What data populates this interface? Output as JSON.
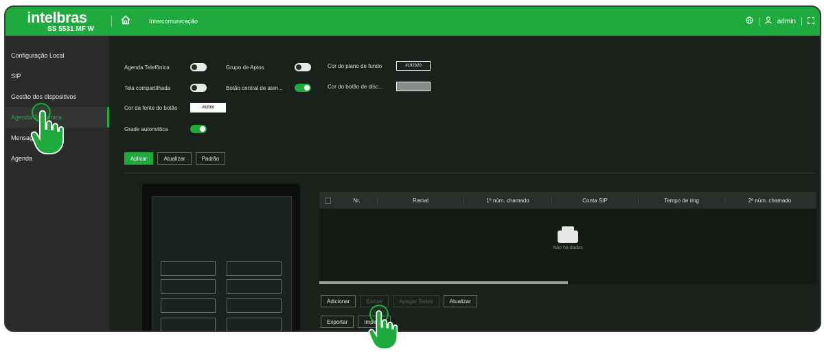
{
  "header": {
    "brand": "intelbras",
    "model": "SS 5531 MF W",
    "title": "Intercomunicação",
    "user": "admin"
  },
  "sidebar": {
    "items": [
      {
        "label": "Configuração Local",
        "active": false
      },
      {
        "label": "SIP",
        "active": false
      },
      {
        "label": "Gestão dos dispositivos",
        "active": false
      },
      {
        "label": "Agenda Telefônica",
        "active": true
      },
      {
        "label": "Mensagens",
        "active": false
      },
      {
        "label": "Agenda",
        "active": false
      }
    ]
  },
  "form": {
    "agenda_telefonica": "Agenda Telefônica",
    "grupo_aptos": "Grupo de Aptos",
    "cor_fundo": "Cor do plano de fundo",
    "cor_fundo_value": "#192320",
    "tela_compartilhada": "Tela compartilhada",
    "botao_central": "Botão central de aten...",
    "cor_botao_disc": "Cor do botão de disc...",
    "cor_fonte": "Cor da fonte do botão",
    "cor_fonte_value": "#fdfdfd",
    "grade_automatica": "Grade automática"
  },
  "buttons": {
    "aplicar": "Aplicar",
    "atualizar": "Atualizar",
    "padrao": "Padrão",
    "adicionar": "Adicionar",
    "excluir": "Excluir",
    "apagar_todos": "Apagar Todos",
    "atualizar2": "Atualizar",
    "exportar": "Exportar",
    "importar": "Importar"
  },
  "table": {
    "columns": [
      "Nr.",
      "Ramal",
      "1º núm. chamado",
      "Conta SIP",
      "Tempo de ring",
      "2º núm. chamado"
    ],
    "empty_text": "Não há dados"
  },
  "colors": {
    "accent": "#1eaa3c",
    "background": "#192320",
    "sidebar": "#2a2c2a"
  }
}
